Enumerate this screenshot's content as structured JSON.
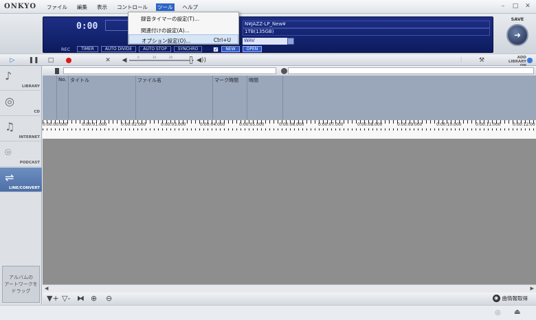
{
  "app": {
    "logo": "ONKYO"
  },
  "menu": [
    "ファイル",
    "編集",
    "表示",
    "コントロール",
    "ツール",
    "ヘルプ"
  ],
  "display": {
    "time": "0:00",
    "path": "N¥JAZZ-LP_New¥",
    "disk": "1TB(135GB)",
    "format": "WAV",
    "rec_label": "REC",
    "rec_buttons": [
      "TIMER",
      "AUTO DIVIDE",
      "AUTO STOP",
      "SYNCHRO"
    ],
    "new_label": "NEW",
    "open_label": "OPEN"
  },
  "save": {
    "label": "SAVE"
  },
  "add_library": {
    "line1": "ADD LIBRARY",
    "line2": "ON"
  },
  "volume": {
    "ticks": [
      "0",
      "10",
      "20"
    ]
  },
  "sidebar": [
    {
      "label": "LIBRARY",
      "icon": "music-note-icon"
    },
    {
      "label": "CD",
      "icon": "cd-icon"
    },
    {
      "label": "INTERNET",
      "icon": "internet-icon"
    },
    {
      "label": "PODCAST",
      "icon": "podcast-icon"
    },
    {
      "label": "LINE/CONVERT",
      "icon": "line-convert-icon"
    }
  ],
  "artwork": {
    "text": "アルバムの\nアートワークを\nドラッグ"
  },
  "table": {
    "columns": [
      "No.",
      "タイトル",
      "ファイル名",
      "マーク時間",
      "時間"
    ]
  },
  "timeline": [
    "0:00:00.000",
    "0:00:01.000",
    "0:00:02.000",
    "0:00:03.000",
    "0:00:04.000",
    "0:00:05.000",
    "0:00:06.000",
    "0:00:07.000",
    "0:00:08.000",
    "0:00:09.000",
    "0:00:10.000",
    "0:00:11.000",
    "0:00:12.00"
  ],
  "bottom": {
    "get_info": "曲情報取得"
  },
  "dropdown": [
    {
      "label": "録音タイマーの設定(T)...",
      "shortcut": ""
    },
    {
      "label": "関連付けの設定(A)...",
      "shortcut": ""
    },
    {
      "label": "オプション設定(O)...",
      "shortcut": "Ctrl+U"
    }
  ],
  "colors": {
    "display_bg": "#0d1b5e",
    "accent": "#2b66c4",
    "record": "#e01818",
    "wave_bg": "#8e8e8e"
  }
}
